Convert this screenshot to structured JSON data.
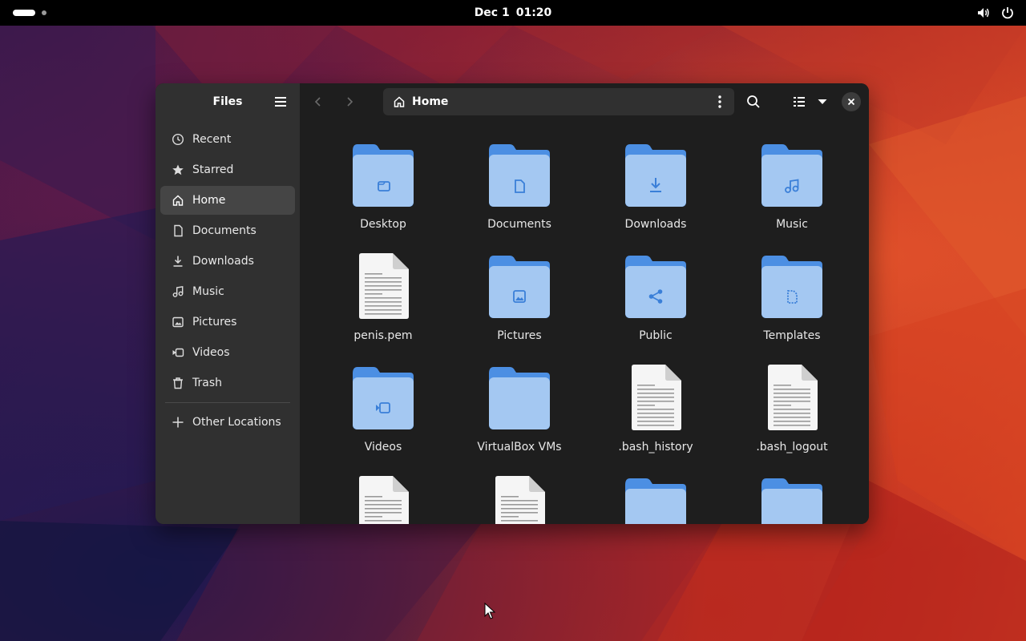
{
  "topbar": {
    "date": "Dec 1",
    "time": "01:20"
  },
  "window": {
    "sidebar": {
      "title": "Files",
      "items": [
        {
          "label": "Recent",
          "icon": "clock-icon"
        },
        {
          "label": "Starred",
          "icon": "star-icon"
        },
        {
          "label": "Home",
          "icon": "home-icon",
          "active": true
        },
        {
          "label": "Documents",
          "icon": "document-icon"
        },
        {
          "label": "Downloads",
          "icon": "download-icon"
        },
        {
          "label": "Music",
          "icon": "music-icon"
        },
        {
          "label": "Pictures",
          "icon": "picture-icon"
        },
        {
          "label": "Videos",
          "icon": "video-icon"
        },
        {
          "label": "Trash",
          "icon": "trash-icon"
        }
      ],
      "other_locations": "Other Locations"
    },
    "pathbar": {
      "location": "Home"
    },
    "files": [
      {
        "name": "Desktop",
        "kind": "folder",
        "emblem": "desktop"
      },
      {
        "name": "Documents",
        "kind": "folder",
        "emblem": "document"
      },
      {
        "name": "Downloads",
        "kind": "folder",
        "emblem": "download"
      },
      {
        "name": "Music",
        "kind": "folder",
        "emblem": "music"
      },
      {
        "name": "penis.pem",
        "kind": "file"
      },
      {
        "name": "Pictures",
        "kind": "folder",
        "emblem": "picture"
      },
      {
        "name": "Public",
        "kind": "folder",
        "emblem": "share"
      },
      {
        "name": "Templates",
        "kind": "folder",
        "emblem": "template"
      },
      {
        "name": "Videos",
        "kind": "folder",
        "emblem": "video"
      },
      {
        "name": "VirtualBox VMs",
        "kind": "folder",
        "emblem": "none"
      },
      {
        "name": ".bash_history",
        "kind": "file"
      },
      {
        "name": ".bash_logout",
        "kind": "file"
      },
      {
        "name": "",
        "kind": "file"
      },
      {
        "name": "",
        "kind": "file"
      },
      {
        "name": "",
        "kind": "folder",
        "emblem": "none"
      },
      {
        "name": "",
        "kind": "folder",
        "emblem": "none"
      }
    ],
    "colors": {
      "folder_body": "#a4c8f2",
      "folder_tab": "#4c8fe3",
      "folder_emblem": "#3a7fd8"
    }
  }
}
